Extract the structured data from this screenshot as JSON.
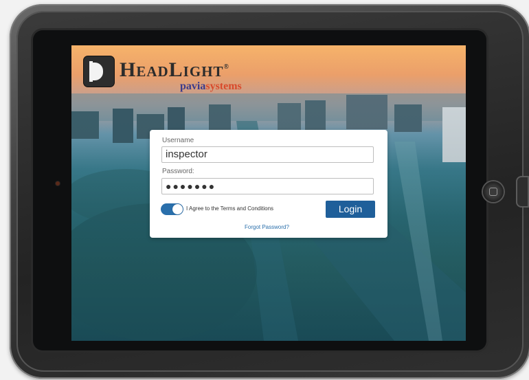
{
  "device": {
    "icons": {
      "camera": "camera-icon",
      "home": "home-button-icon",
      "side": "side-button"
    }
  },
  "logo": {
    "title": "HeadLight",
    "registered": "®",
    "subtitle_a": "pavia",
    "subtitle_b": "systems"
  },
  "login": {
    "username_label": "Username",
    "username_value": "inspector",
    "password_label": "Password:",
    "password_value": "●●●●●●●",
    "terms_toggle_on": true,
    "terms_label": "I Agree to the Terms and Conditions",
    "login_button": "Login",
    "forgot_link": "Forgot Password?"
  },
  "colors": {
    "accent": "#1f5f9a",
    "toggle": "#2a6fab",
    "subtitle_a": "#3b3b8c",
    "subtitle_b": "#d94a2b"
  }
}
